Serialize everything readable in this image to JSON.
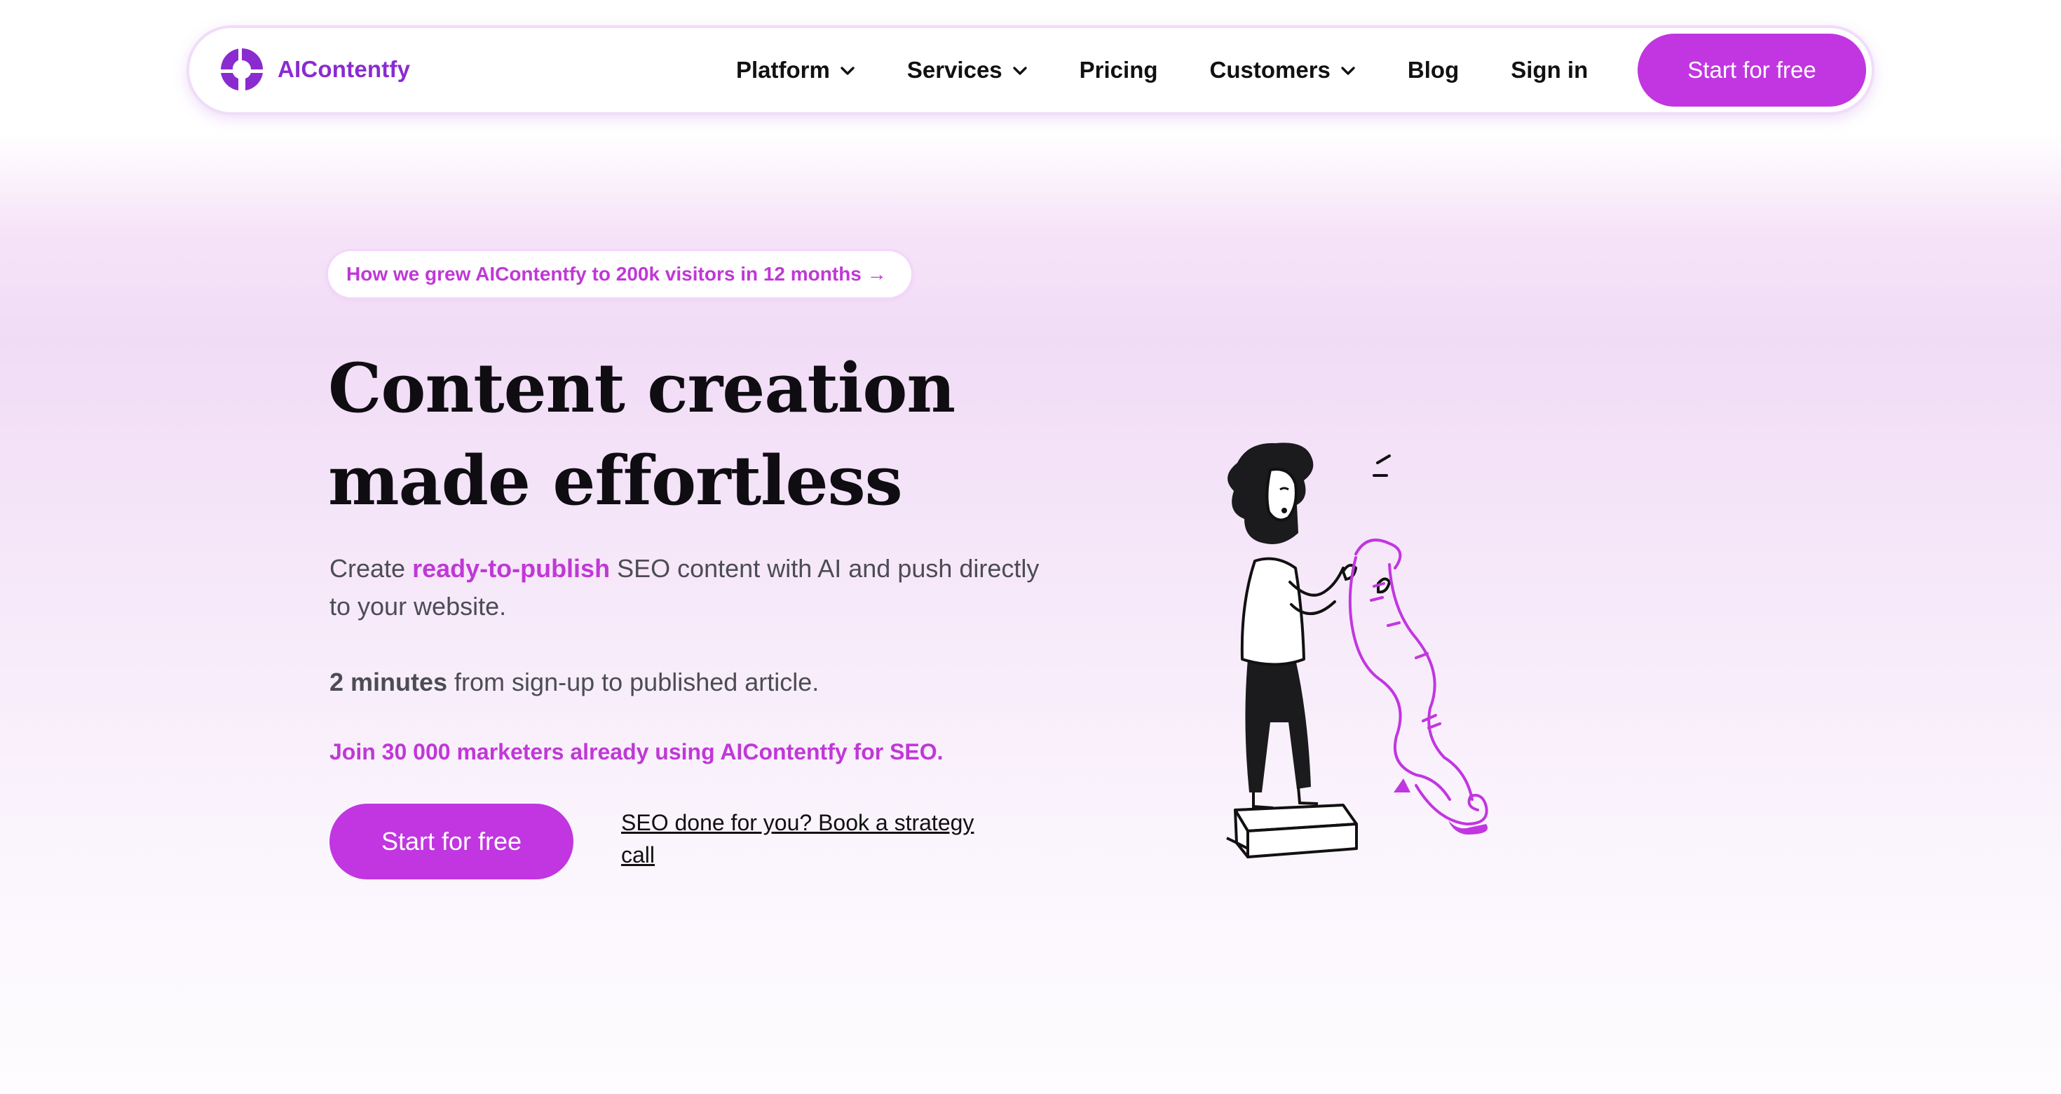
{
  "brand": {
    "name": "AIContentfy",
    "accent": "#c136e0",
    "logo_color": "#8a2bd0"
  },
  "nav": {
    "items": [
      {
        "label": "Platform",
        "has_dropdown": true
      },
      {
        "label": "Services",
        "has_dropdown": true
      },
      {
        "label": "Pricing",
        "has_dropdown": false
      },
      {
        "label": "Customers",
        "has_dropdown": true
      },
      {
        "label": "Blog",
        "has_dropdown": false
      },
      {
        "label": "Sign in",
        "has_dropdown": false
      }
    ],
    "cta_label": "Start for free"
  },
  "hero": {
    "announcement": "How we grew AIContentfy to 200k visitors in 12 months →",
    "headline": "Content creation made effortless",
    "sub_before": "Create ",
    "sub_highlight": "ready-to-publish",
    "sub_after": " SEO content with AI and push directly to your website.",
    "stat_bold": "2 minutes",
    "stat_rest": " from sign-up to published article.",
    "social_proof": "Join 30 000 marketers already using AIContentfy for SEO.",
    "cta_label": "Start for free",
    "secondary_link": "SEO done for you? Book a strategy call"
  },
  "icons": {
    "dropdown": "chevron-down-icon",
    "logo": "aicontentfy-logo-icon",
    "illustration": "person-reading-long-scroll-illustration"
  }
}
